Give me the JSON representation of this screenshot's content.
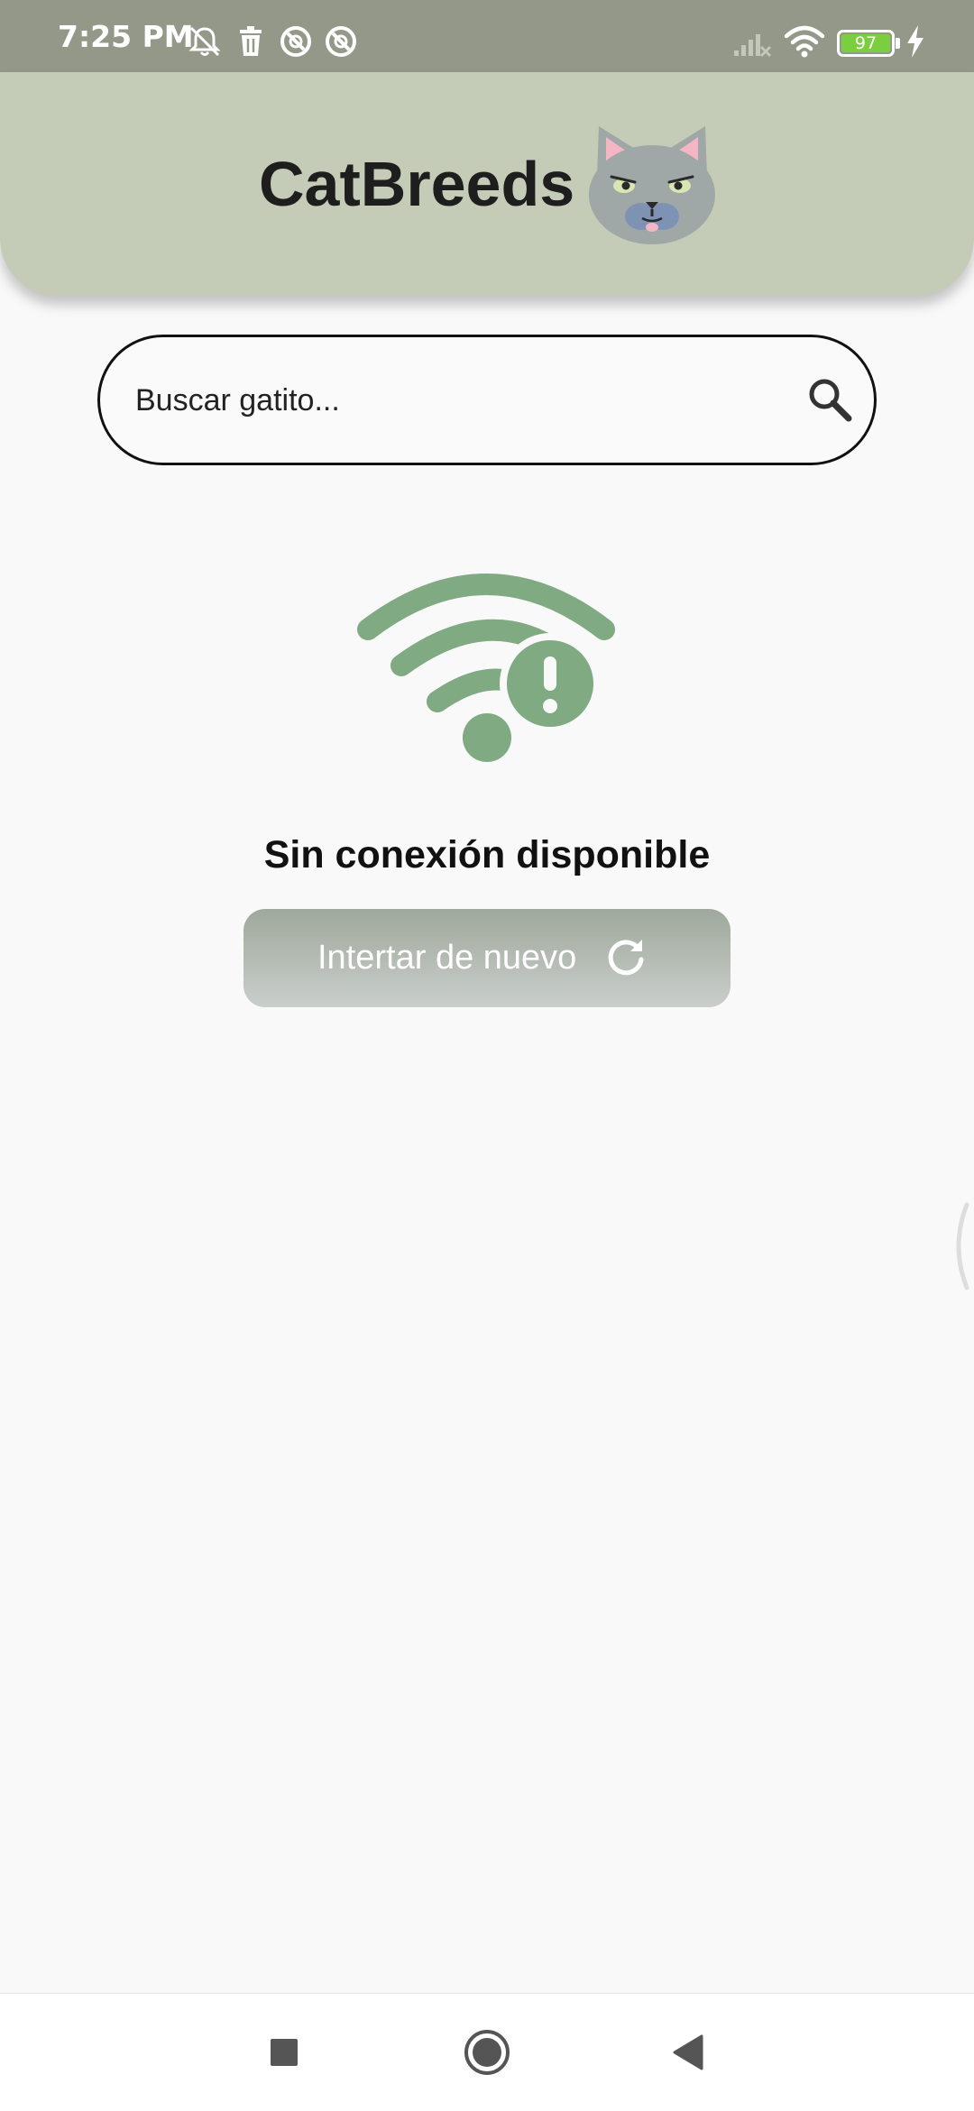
{
  "status_bar": {
    "time": "7:25 PM",
    "battery_level": "97",
    "icons_left": [
      "notifications-muted-icon",
      "trash-icon",
      "app-notification-icon",
      "app-notification-icon"
    ],
    "icons_right": [
      "cell-signal-off-icon",
      "wifi-icon",
      "battery-icon",
      "charging-icon"
    ]
  },
  "app_bar": {
    "title": "CatBreeds",
    "logo": "cat-face-logo",
    "background_color": "#c4cbb6"
  },
  "search": {
    "placeholder": "Buscar gatito...",
    "value": "",
    "icon": "search-icon"
  },
  "offline": {
    "icon": "wifi-alert-icon",
    "icon_color": "#7faa82",
    "message": "Sin conexión disponible",
    "retry_label": "Intertar de nuevo",
    "retry_icon": "refresh-icon"
  },
  "navigation_bar": {
    "buttons": [
      "recents-button",
      "home-button",
      "back-button"
    ]
  }
}
